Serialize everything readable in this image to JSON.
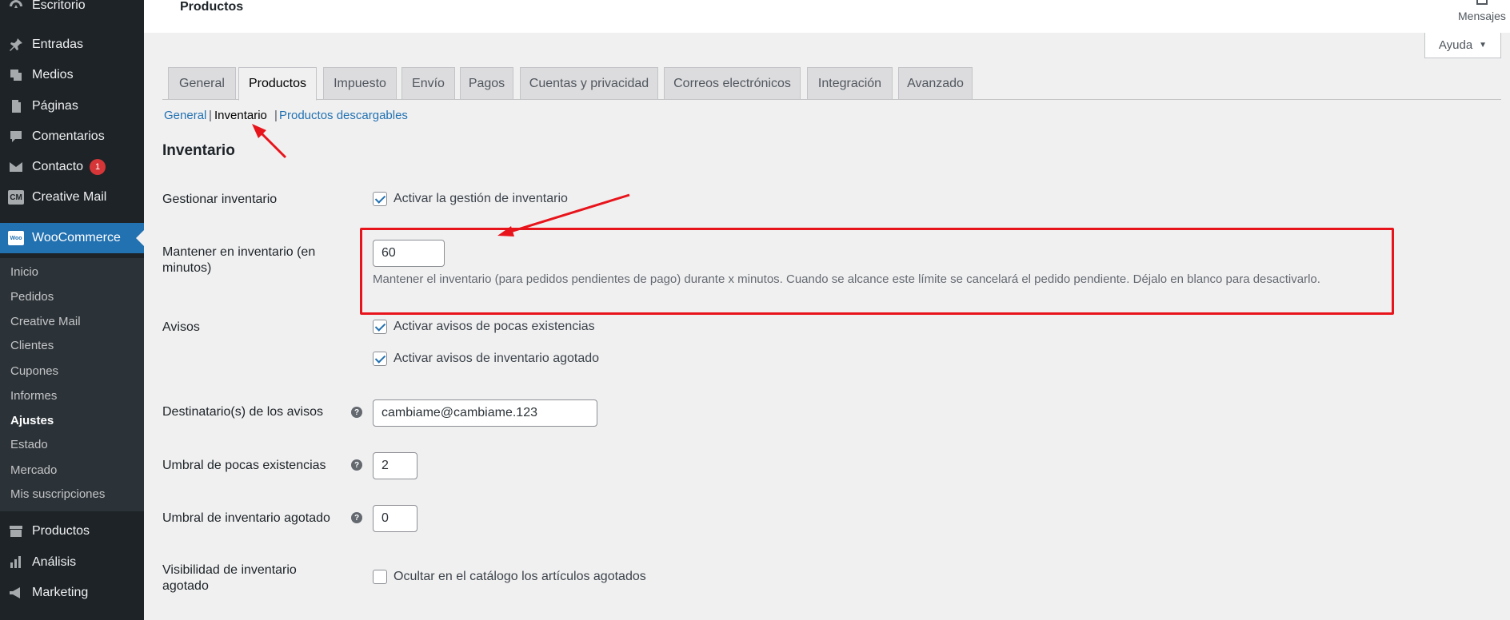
{
  "sidebar": {
    "items": [
      {
        "label": "Escritorio",
        "icon": "dashboard-icon"
      },
      {
        "label": "Entradas",
        "icon": "pin-icon"
      },
      {
        "label": "Medios",
        "icon": "media-icon"
      },
      {
        "label": "Páginas",
        "icon": "pages-icon"
      },
      {
        "label": "Comentarios",
        "icon": "comments-icon"
      },
      {
        "label": "Contacto",
        "icon": "mail-icon",
        "badge": "1"
      },
      {
        "label": "Creative Mail",
        "icon": "cm-icon",
        "logo": "CM"
      },
      {
        "label": "WooCommerce",
        "icon": "woo-icon",
        "logo": "Woo"
      },
      {
        "label": "Productos",
        "icon": "archive-icon"
      },
      {
        "label": "Análisis",
        "icon": "chart-icon"
      },
      {
        "label": "Marketing",
        "icon": "megaphone-icon"
      }
    ],
    "submenu": [
      "Inicio",
      "Pedidos",
      "Creative Mail",
      "Clientes",
      "Cupones",
      "Informes",
      "Ajustes",
      "Estado",
      "Mercado",
      "Mis suscripciones"
    ],
    "active_sub": "Ajustes"
  },
  "header": {
    "title": "Productos",
    "messages": "Mensajes",
    "help": "Ayuda"
  },
  "tabs": [
    "General",
    "Productos",
    "Impuesto",
    "Envío",
    "Pagos",
    "Cuentas y privacidad",
    "Correos electrónicos",
    "Integración",
    "Avanzado"
  ],
  "active_tab": "Productos",
  "subsub": {
    "general": "General",
    "inventario": "Inventario",
    "descargables": "Productos descargables",
    "sep": "|"
  },
  "section_title": "Inventario",
  "form": {
    "manage_label": "Gestionar inventario",
    "manage_cb": "Activar la gestión de inventario",
    "hold_label": "Mantener en inventario (en minutos)",
    "hold_value": "60",
    "hold_desc": "Mantener el inventario (para pedidos pendientes de pago) durante x minutos. Cuando se alcance este límite se cancelará el pedido pendiente. Déjalo en blanco para desactivarlo.",
    "notices_label": "Avisos",
    "notice_low": "Activar avisos de pocas existencias",
    "notice_out": "Activar avisos de inventario agotado",
    "recipient_label": "Destinatario(s) de los avisos",
    "recipient_value": "cambiame@cambiame.123",
    "low_label": "Umbral de pocas existencias",
    "low_value": "2",
    "out_label": "Umbral de inventario agotado",
    "out_value": "0",
    "visibility_label": "Visibilidad de inventario agotado",
    "visibility_cb": "Ocultar en el catálogo los artículos agotados",
    "help_glyph": "?"
  },
  "colors": {
    "sidebar_bg": "#1d2327",
    "accent": "#2271b1",
    "highlight": "#e8141b"
  }
}
